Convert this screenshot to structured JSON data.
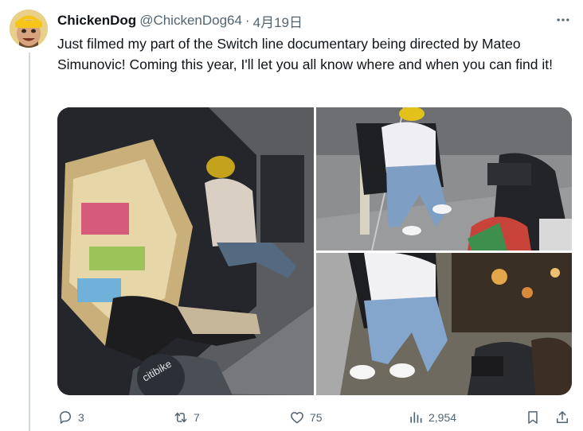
{
  "tweet": {
    "display_name": "ChickenDog",
    "handle": "@ChickenDog64",
    "separator": "·",
    "date": "4月19日",
    "text": "Just filmed my part of the Switch line documentary being directed by Mateo Simunovic! Coming this year, I'll let you all know where and when you can find it!"
  },
  "icons": {
    "more": "more-horizontal-icon",
    "reply": "reply-bubble-icon",
    "repost": "repost-arrows-icon",
    "like": "heart-icon",
    "views": "bar-chart-icon",
    "bookmark": "bookmark-icon",
    "share": "share-upload-icon"
  },
  "media": {
    "photo_count": 3
  },
  "actions": {
    "replies": "3",
    "reposts": "7",
    "likes": "75",
    "views": "2,954"
  },
  "colors": {
    "text_primary": "#0f1419",
    "text_secondary": "#536471",
    "thread_line": "#cfd9de",
    "avatar_bg": "#f2c84b"
  }
}
